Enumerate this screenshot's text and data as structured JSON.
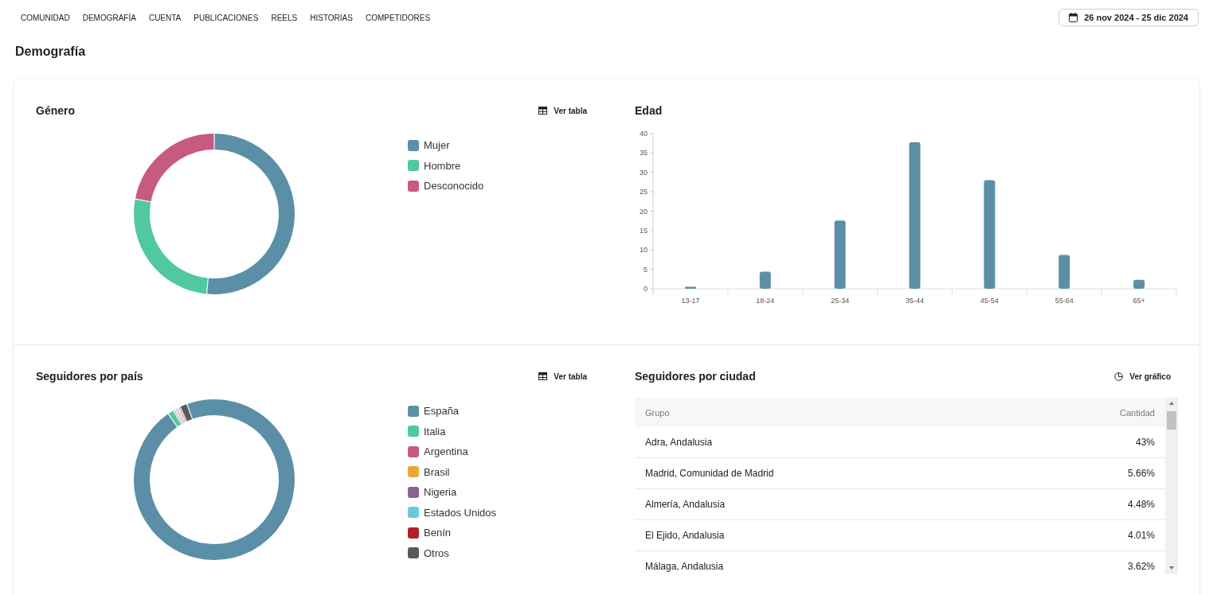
{
  "nav": {
    "tabs": [
      {
        "label": "COMUNIDAD"
      },
      {
        "label": "DEMOGRAFÍA"
      },
      {
        "label": "CUENTA"
      },
      {
        "label": "PUBLICACIONES"
      },
      {
        "label": "REELS"
      },
      {
        "label": "HISTORIAS"
      },
      {
        "label": "COMPETIDORES"
      }
    ],
    "date_range": "26 nov 2024 - 25 dic 2024"
  },
  "page_title": "Demografía",
  "gender": {
    "title": "Género",
    "action": "Ver tabla",
    "legend": [
      {
        "label": "Mujer",
        "color": "#5b8fa8"
      },
      {
        "label": "Hombre",
        "color": "#50c8a0"
      },
      {
        "label": "Desconocido",
        "color": "#c75a80"
      }
    ]
  },
  "age": {
    "title": "Edad",
    "chart_data": {
      "type": "bar",
      "categories": [
        "13-17",
        "18-24",
        "25-34",
        "35-44",
        "45-54",
        "55-64",
        "65+"
      ],
      "values": [
        0.5,
        4.4,
        17.6,
        37.8,
        28,
        8.7,
        2.3
      ],
      "ylim": [
        0,
        40
      ],
      "yticks": [
        0,
        5,
        10,
        15,
        20,
        25,
        30,
        35,
        40
      ]
    }
  },
  "country": {
    "title": "Seguidores por país",
    "action": "Ver tabla",
    "legend": [
      {
        "label": "España",
        "color": "#5b8fa8"
      },
      {
        "label": "Italia",
        "color": "#50c8a0"
      },
      {
        "label": "Argentina",
        "color": "#c75a80"
      },
      {
        "label": "Brasil",
        "color": "#e8a838"
      },
      {
        "label": "Nigeria",
        "color": "#8a6290"
      },
      {
        "label": "Estados Unidos",
        "color": "#6cc8d8"
      },
      {
        "label": "Benín",
        "color": "#b0222a"
      },
      {
        "label": "Otros",
        "color": "#5a5a5a"
      }
    ]
  },
  "city": {
    "title": "Seguidores por ciudad",
    "action": "Ver gráfico",
    "columns": [
      "Grupo",
      "Cantidad"
    ],
    "rows": [
      [
        "Adra, Andalusia",
        "43%"
      ],
      [
        "Madrid, Comunidad de Madrid",
        "5.66%"
      ],
      [
        "Almería, Andalusia",
        "4.48%"
      ],
      [
        "El Ejido, Andalusia",
        "4.01%"
      ],
      [
        "Málaga, Andalusia",
        "3.62%"
      ]
    ]
  }
}
